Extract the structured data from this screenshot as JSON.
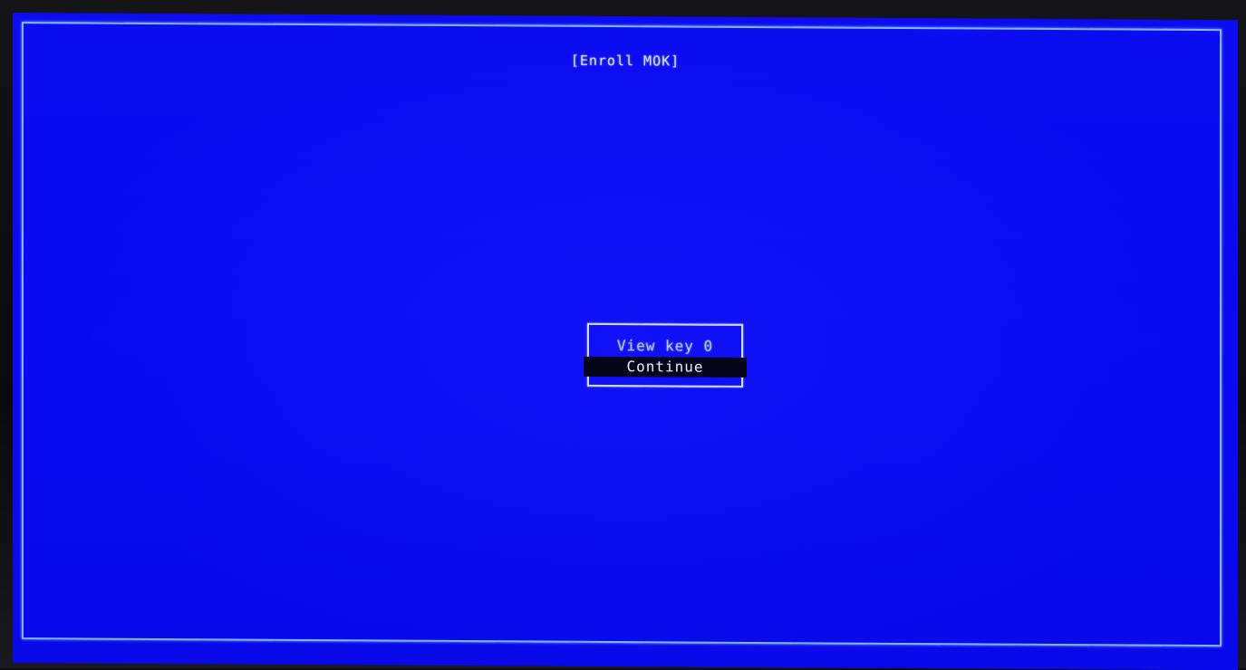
{
  "screen": {
    "title": "[Enroll MOK]",
    "background_color": "#0a0af2",
    "border_color": "#7fb6ff"
  },
  "menu": {
    "items": [
      {
        "label": "View key 0",
        "selected": false
      },
      {
        "label": "Continue",
        "selected": true
      }
    ],
    "selected_background": "#06061a"
  }
}
